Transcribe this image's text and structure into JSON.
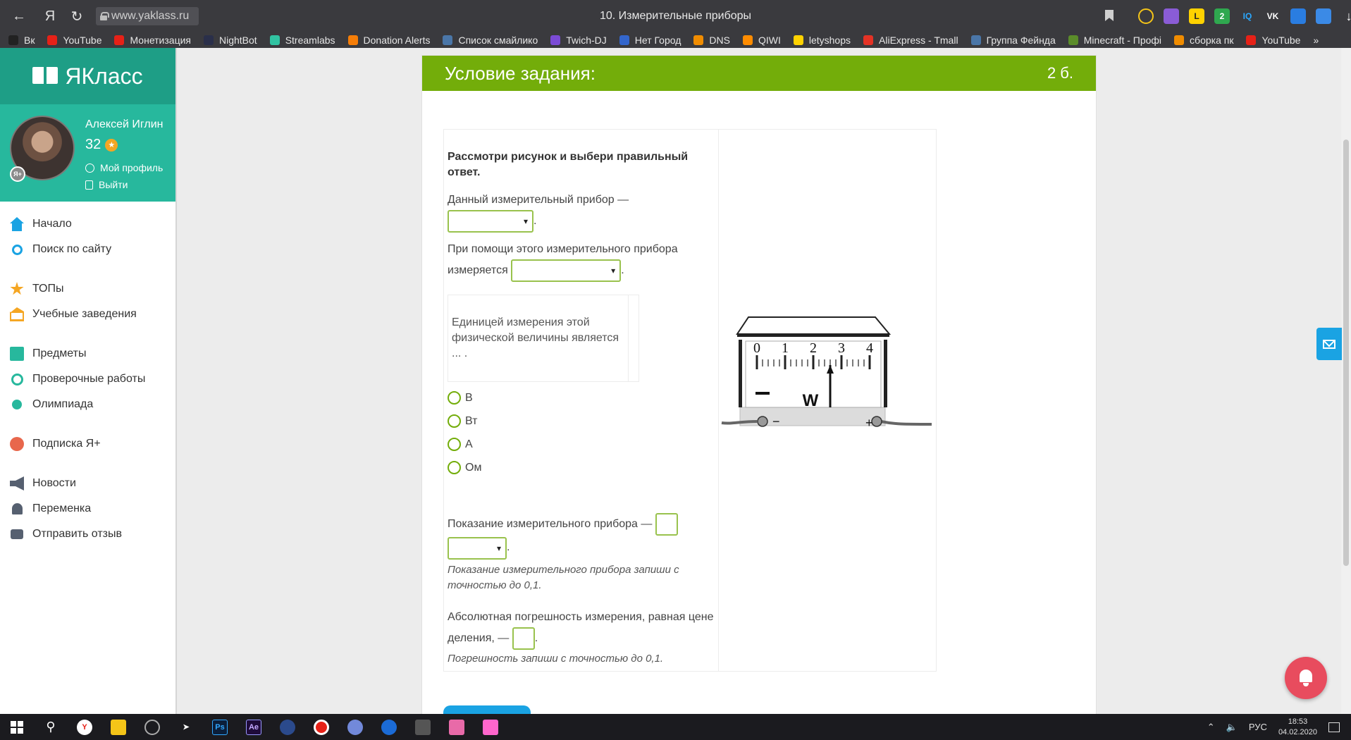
{
  "browser": {
    "address": "www.yaklass.ru",
    "title": "10. Измерительные приборы",
    "bookmarks": [
      {
        "label": "Вк",
        "color": "#222222"
      },
      {
        "label": "YouTube",
        "color": "#e62117"
      },
      {
        "label": "Монетизация",
        "color": "#e62117"
      },
      {
        "label": "NightBot",
        "color": "#2a2f4a"
      },
      {
        "label": "Streamlabs",
        "color": "#31c3a2"
      },
      {
        "label": "Donation Alerts",
        "color": "#f57d07"
      },
      {
        "label": "Список смайлико",
        "color": "#4a76a8"
      },
      {
        "label": "Twich-DJ",
        "color": "#7b4bd6"
      },
      {
        "label": "Нет Город",
        "color": "#3366cc"
      },
      {
        "label": "DNS",
        "color": "#f08c00"
      },
      {
        "label": "QIWI",
        "color": "#ff8c00"
      },
      {
        "label": "letyshops",
        "color": "#ffd200"
      },
      {
        "label": "AliExpress - Tmall",
        "color": "#e43225"
      },
      {
        "label": "Группа Фейнда",
        "color": "#4a76a8"
      },
      {
        "label": "Minecraft - Профі",
        "color": "#5b8c2a"
      },
      {
        "label": "сборка пк",
        "color": "#f08c00"
      },
      {
        "label": "YouTube",
        "color": "#e62117"
      }
    ],
    "more_bookmarks": "»"
  },
  "sidebar": {
    "logo": "ЯКласс",
    "profile": {
      "name": "Алексей Иглин",
      "points": "32",
      "badge": "Я+",
      "my_profile": "Мой профиль",
      "logout": "Выйти"
    },
    "items": [
      {
        "label": "Начало",
        "icon": "home-icon"
      },
      {
        "label": "Поиск по сайту",
        "icon": "search-icon"
      },
      {
        "label": "ТОПы",
        "icon": "star-icon"
      },
      {
        "label": "Учебные заведения",
        "icon": "institution-icon"
      },
      {
        "label": "Предметы",
        "icon": "books-icon"
      },
      {
        "label": "Проверочные работы",
        "icon": "check-circle-icon"
      },
      {
        "label": "Олимпиада",
        "icon": "medal-icon"
      },
      {
        "label": "Подписка Я+",
        "icon": "ya-plus-icon"
      },
      {
        "label": "Новости",
        "icon": "megaphone-icon"
      },
      {
        "label": "Переменка",
        "icon": "bell-icon"
      },
      {
        "label": "Отправить отзыв",
        "icon": "comment-icon"
      }
    ]
  },
  "task": {
    "header_title": "Условие задания:",
    "header_points": "2 б.",
    "intro": "Рассмотри рисунок и выбери правильный ответ.",
    "q1": "Данный измерительный прибор —",
    "q2": "При помощи этого измерительного прибора измеряется",
    "unit_question": "Единицей измерения этой физической величины является ... .",
    "options": [
      "В",
      "Вт",
      "А",
      "Ом"
    ],
    "q3": "Показание измерительного прибора —",
    "q3_hint": "Показание измерительного прибора запиши с точностью до 0,1.",
    "q4": "Абсолютная погрешность измерения, равная цене деления, —",
    "q4_hint": "Погрешность запиши с точностью до 0,1.",
    "period": "."
  },
  "meter": {
    "scale_labels": [
      "0",
      "1",
      "2",
      "3",
      "4"
    ],
    "unit_letter": "W",
    "minus_sign": "−",
    "plus_sign": "+",
    "scale_min": 0,
    "scale_max": 4,
    "minor_divisions": 20,
    "pointer_value": 2.6
  },
  "taskbar": {
    "lang": "РУС",
    "time": "18:53",
    "date": "04.02.2020"
  }
}
